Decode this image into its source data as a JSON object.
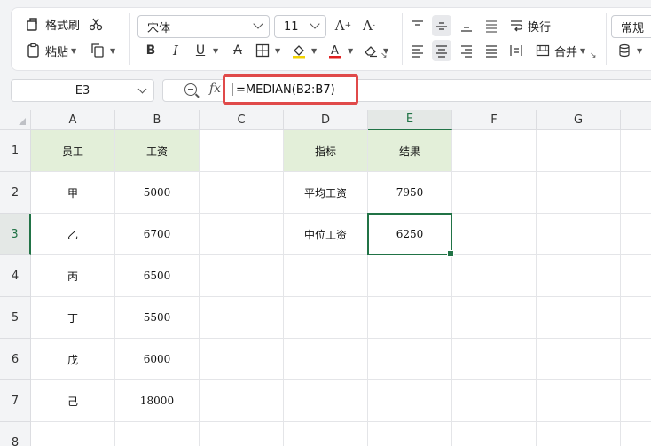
{
  "ribbon": {
    "format_painter": "格式刷",
    "paste": "粘贴",
    "font_name": "宋体",
    "font_size": "11",
    "wrap_text": "换行",
    "merge": "合并",
    "number_format": "常规"
  },
  "name_box": "E3",
  "formula": "=MEDIAN(B2:B7)",
  "columns": [
    "A",
    "B",
    "C",
    "D",
    "E",
    "F",
    "G"
  ],
  "rows": [
    "1",
    "2",
    "3",
    "4",
    "5",
    "6",
    "7",
    "8"
  ],
  "cells": {
    "A1": "员工",
    "B1": "工资",
    "D1": "指标",
    "E1": "结果",
    "A2": "甲",
    "B2": "5000",
    "D2": "平均工资",
    "E2": "7950",
    "A3": "乙",
    "B3": "6700",
    "D3": "中位工资",
    "E3": "6250",
    "A4": "丙",
    "B4": "6500",
    "A5": "丁",
    "B5": "5500",
    "A6": "戊",
    "B6": "6000",
    "A7": "己",
    "B7": "18000"
  },
  "colors": {
    "accent": "#217346",
    "header_fill": "#e3efd9",
    "highlight": "#e04a4a"
  }
}
